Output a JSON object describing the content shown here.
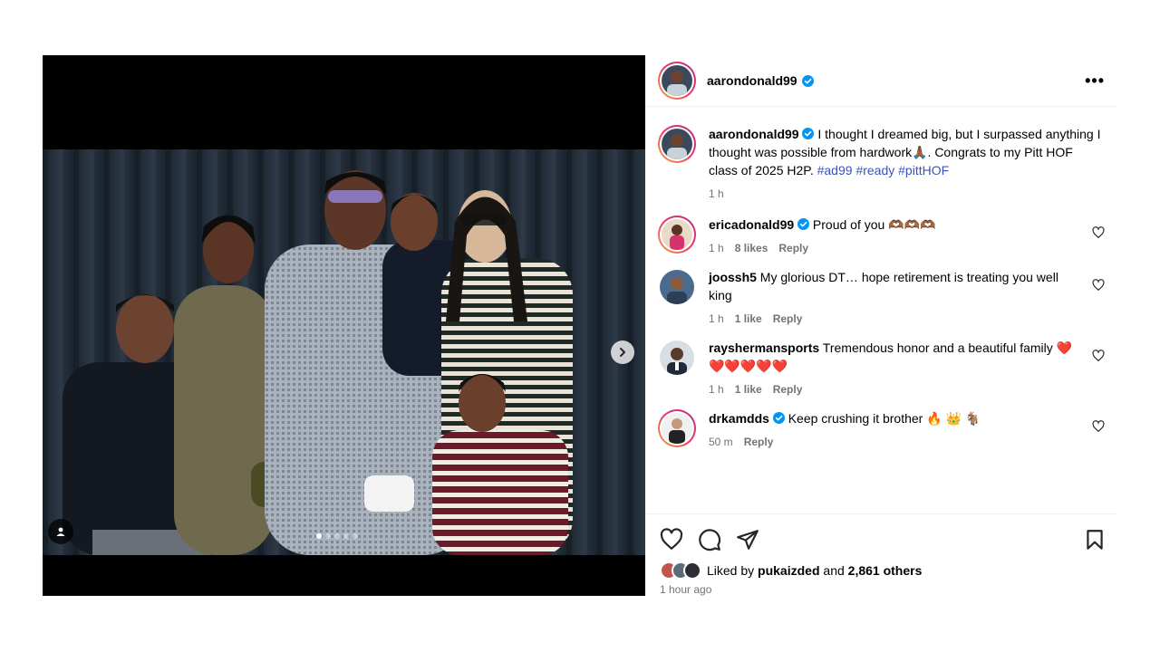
{
  "post": {
    "username": "aarondonald99",
    "more_label": "•••"
  },
  "caption": {
    "username": "aarondonald99",
    "text": " I thought I dreamed big, but I surpassed anything I thought was possible from hardwork🙏🏾. Congrats to my Pitt HOF class of 2025 H2P. ",
    "hashtags": [
      "#ad99",
      "#ready",
      "#pittHOF"
    ],
    "time": "1 h"
  },
  "comments": [
    {
      "username": "ericadonald99",
      "verified": true,
      "text": " Proud of you 🫶🏾🫶🏾🫶🏾",
      "time": "1 h",
      "likes": "8 likes",
      "reply": "Reply"
    },
    {
      "username": "joossh5",
      "verified": false,
      "text": " My glorious DT… hope retirement is treating you well king",
      "time": "1 h",
      "likes": "1 like",
      "reply": "Reply"
    },
    {
      "username": "rayshermansports",
      "verified": false,
      "text": " Tremendous honor and a beautiful family ❤️❤️❤️❤️❤️❤️",
      "time": "1 h",
      "likes": "1 like",
      "reply": "Reply"
    },
    {
      "username": "drkamdds",
      "verified": true,
      "text": " Keep crushing it brother 🔥 👑 🐐",
      "time": "50 m",
      "likes": "",
      "reply": "Reply"
    }
  ],
  "likes": {
    "prefix": "Liked by ",
    "user": "pukaizded",
    "middle": " and ",
    "others": "2,861 others"
  },
  "posted_ago": "1 hour ago",
  "carousel": {
    "total": 5,
    "active": 1
  },
  "icons": {
    "like": "heart-icon",
    "comment": "comment-icon",
    "share": "send-icon",
    "save": "bookmark-icon",
    "next": "chevron-right-icon",
    "tag": "person-tag-icon"
  },
  "colors": {
    "verified": "#0095f6",
    "hashtag": "#3a54b8",
    "muted": "#737373"
  }
}
